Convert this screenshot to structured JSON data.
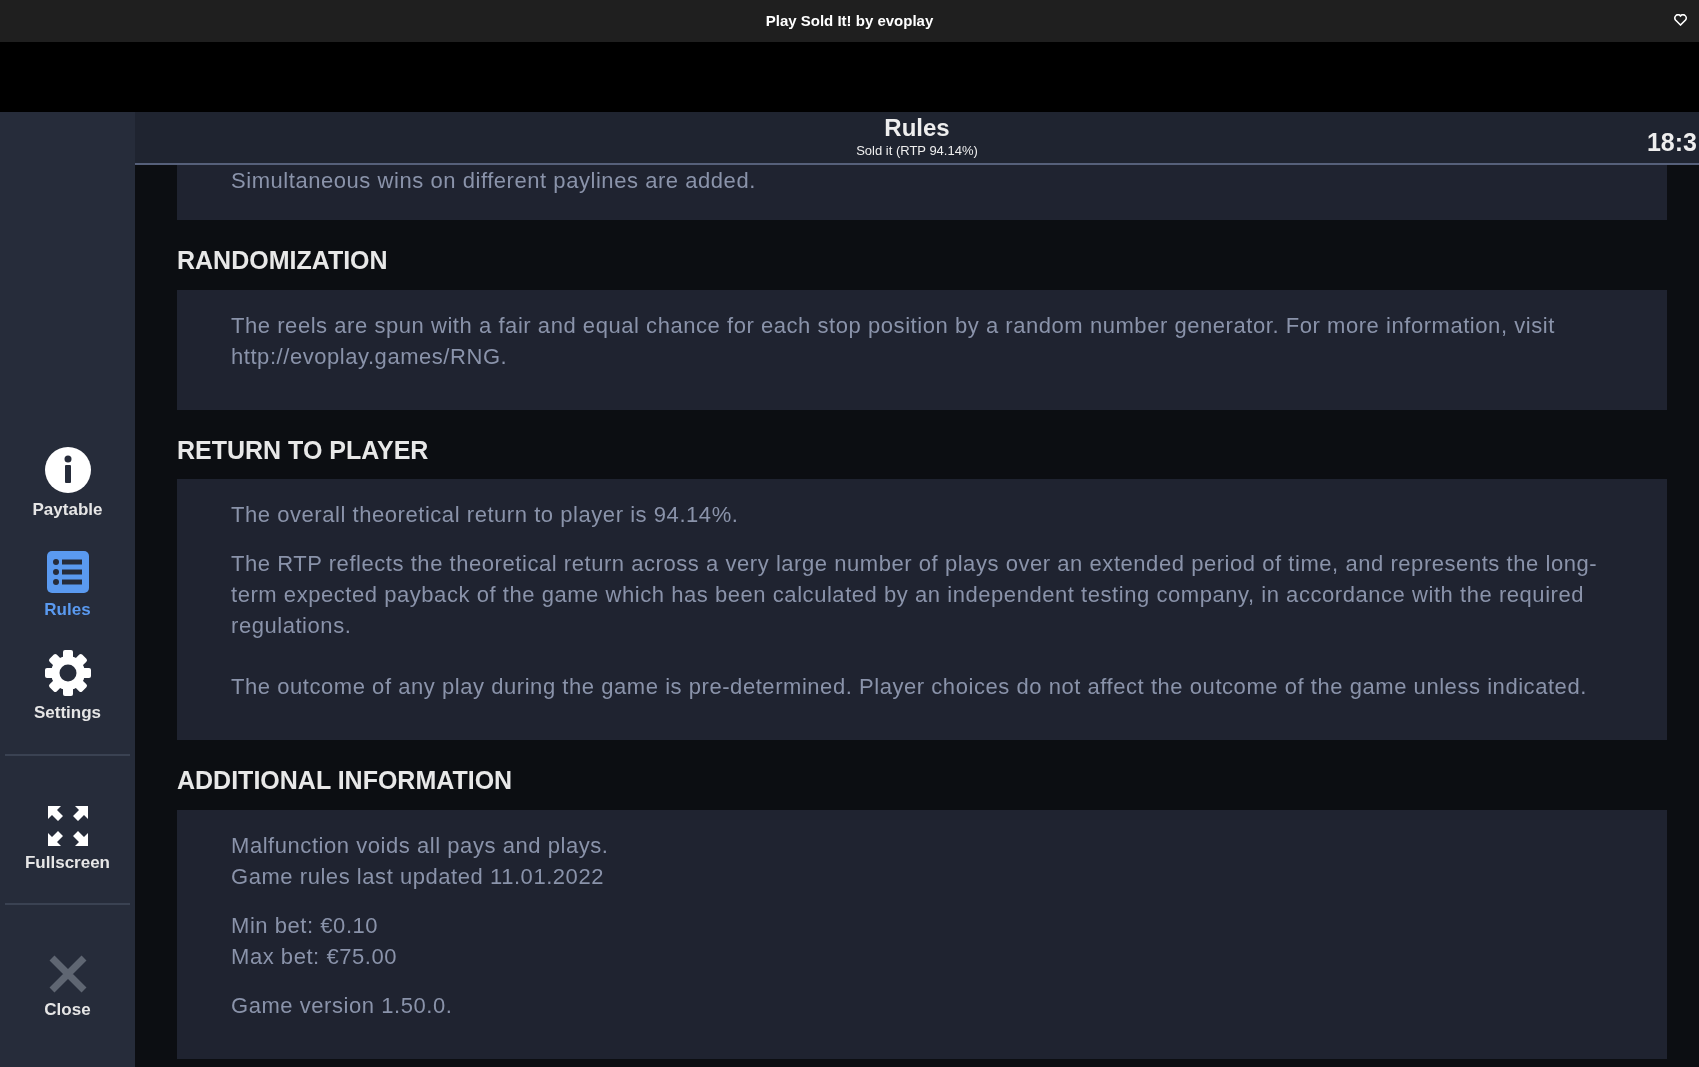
{
  "window": {
    "title": "Play Sold It! by evoplay"
  },
  "sidebar": {
    "items": [
      {
        "label": "Paytable",
        "selected": false
      },
      {
        "label": "Rules",
        "selected": true
      },
      {
        "label": "Settings",
        "selected": false
      },
      {
        "label": "Fullscreen",
        "selected": false
      },
      {
        "label": "Close",
        "selected": false
      }
    ]
  },
  "header": {
    "title": "Rules",
    "subtitle": "Sold it (RTP 94.14%)",
    "time": "18:3"
  },
  "sections": [
    {
      "blocks": [
        [
          "Simultaneous wins on different paylines are added."
        ]
      ]
    },
    {
      "heading": "RANDOMIZATION",
      "blocks": [
        [
          "The reels are spun with a fair and equal chance for each stop position by a random number generator. For more information, visit http://evoplay.games/RNG."
        ]
      ]
    },
    {
      "heading": "RETURN TO PLAYER",
      "blocks": [
        [
          "The overall theoretical return to player is 94.14%."
        ],
        [
          "The RTP reflects the theoretical return across a very large number of plays over an extended period of time, and represents the long-term expected payback of the game which has been calculated by an independent testing company, in accordance with the required regulations."
        ],
        [
          "The outcome of any play during the game is pre-determined. Player choices do not affect the outcome of the game unless indicated."
        ]
      ]
    },
    {
      "heading": "ADDITIONAL INFORMATION",
      "blocks": [
        [
          "Malfunction voids all pays and plays.",
          "Game rules last updated 11.01.2022"
        ],
        [
          "Min bet: €0.10",
          "Max bet: €75.00"
        ],
        [
          "Game version 1.50.0."
        ]
      ]
    }
  ]
}
